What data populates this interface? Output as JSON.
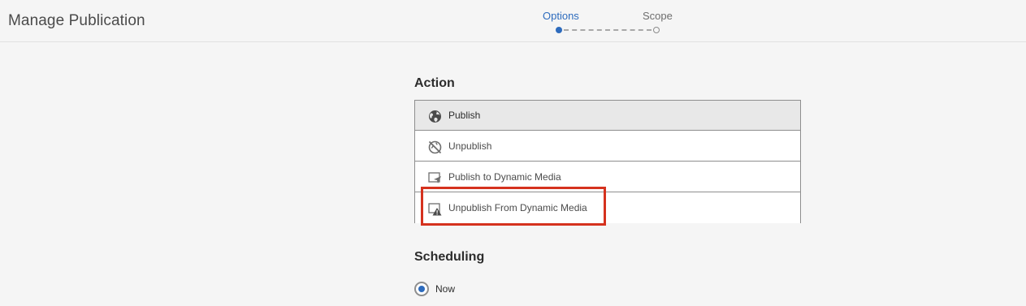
{
  "header": {
    "title": "Manage Publication"
  },
  "stepper": {
    "steps": [
      {
        "label": "Options",
        "state": "active"
      },
      {
        "label": "Scope",
        "state": "inactive"
      }
    ],
    "active_color": "#2d6bbd"
  },
  "action": {
    "title": "Action",
    "items": [
      {
        "label": "Publish",
        "icon": "globe-icon",
        "selected": true
      },
      {
        "label": "Unpublish",
        "icon": "globe-disabled-icon",
        "selected": false
      },
      {
        "label": "Publish to Dynamic Media",
        "icon": "publish-dm-icon",
        "selected": false
      },
      {
        "label": "Unpublish From Dynamic Media",
        "icon": "unpublish-dm-icon",
        "selected": false
      }
    ],
    "highlight_color": "#d5321e"
  },
  "scheduling": {
    "title": "Scheduling",
    "options": [
      {
        "label": "Now",
        "selected": true
      }
    ]
  }
}
